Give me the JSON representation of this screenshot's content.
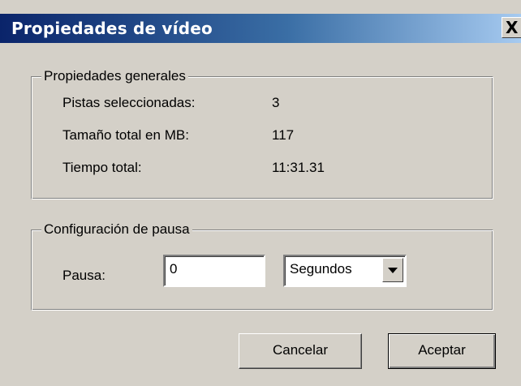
{
  "window": {
    "title": "Propiedades de vídeo",
    "close_label": "X"
  },
  "general": {
    "legend": "Propiedades generales",
    "rows": [
      {
        "label": "Pistas seleccionadas:",
        "value": "3"
      },
      {
        "label": "Tamaño total en MB:",
        "value": "117"
      },
      {
        "label": "Tiempo total:",
        "value": "11:31.31"
      }
    ]
  },
  "pause": {
    "legend": "Configuración de pausa",
    "label": "Pausa:",
    "value": "0",
    "unit_selected": "Segundos"
  },
  "buttons": {
    "cancel": "Cancelar",
    "accept": "Aceptar"
  }
}
